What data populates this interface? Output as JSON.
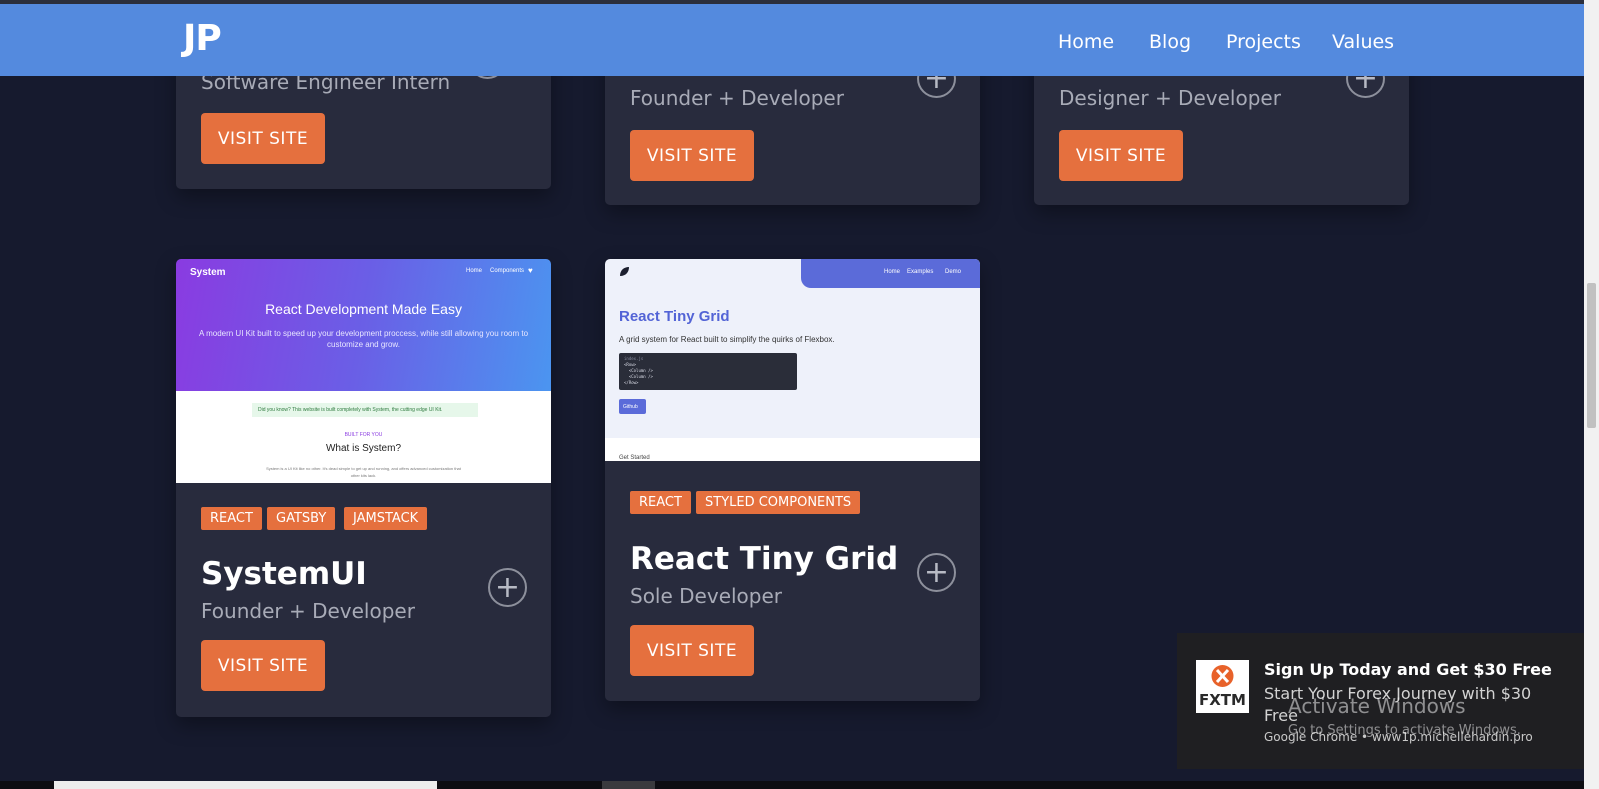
{
  "nav": {
    "logo": "JP",
    "links": [
      "Home",
      "Blog",
      "Projects",
      "Values"
    ]
  },
  "top_cards": [
    {
      "role": "Software Engineer Intern",
      "button": "VISIT SITE"
    },
    {
      "role": "Founder + Developer",
      "button": "VISIT SITE"
    },
    {
      "role": "Designer + Developer",
      "button": "VISIT SITE"
    }
  ],
  "systemui_card": {
    "preview": {
      "brand": "System",
      "nav": [
        "Home",
        "Components",
        "♥"
      ],
      "headline": "React Development Made Easy",
      "subline": "A modern UI Kit built to speed up your development proccess, while still allowing you room to customize and grow.",
      "notice": "Did you know? This website is built completely with System, the cutting edge UI Kit.",
      "eyebrow": "BUILT FOR YOU",
      "section_title": "What is System?",
      "section_text": "System is a UI Kit like no other. It's dead simple to get up and running, and offers advanced customization that other kits lack."
    },
    "tags": [
      "REACT",
      "GATSBY",
      "JAMSTACK"
    ],
    "title": "SystemUI",
    "role": "Founder + Developer",
    "button": "VISIT SITE",
    "expand": "+"
  },
  "tinygrid_card": {
    "preview": {
      "nav": [
        "Home",
        "Examples",
        "Demo"
      ],
      "headline": "React Tiny Grid",
      "subline": "A grid system for React built to simplify the quirks of Flexbox.",
      "code": [
        "index.js",
        "<Row>",
        "  <Column />",
        "  <Column />",
        "</Row>"
      ],
      "button": "Github",
      "footer": "Get Started"
    },
    "tags": [
      "REACT",
      "STYLED COMPONENTS"
    ],
    "title": "React Tiny Grid",
    "role": "Sole Developer",
    "button": "VISIT SITE",
    "expand": "+"
  },
  "notification": {
    "title": "Sign Up Today and Get $30 Free",
    "body": "Start Your Forex Journey with $30 Free",
    "source": "Google Chrome • www1p.michellehardin.pro",
    "logo_text": "FXTM",
    "brand_colors": {
      "orange": "#e8622a",
      "dark": "#2a2a2a"
    }
  },
  "watermark": {
    "title": "Activate Windows",
    "subtitle": "Go to Settings to activate Windows."
  },
  "colors": {
    "navbar": "#548ade",
    "page_bg": "#161a2e",
    "card_bg": "#282b3d",
    "accent": "#e5703e"
  }
}
